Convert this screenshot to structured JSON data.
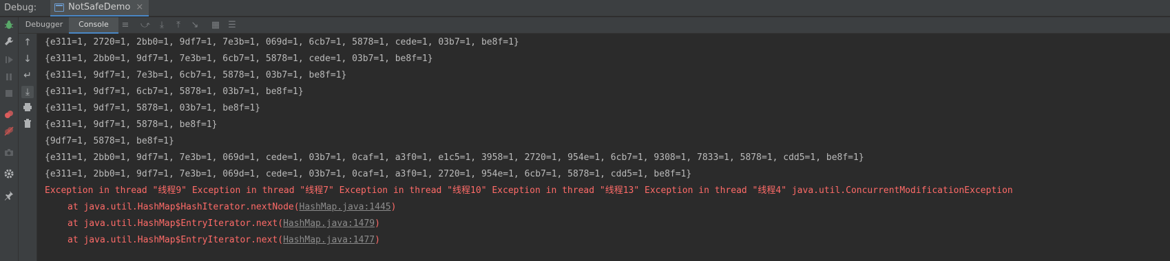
{
  "debug_bar": {
    "label": "Debug:",
    "session_tab": {
      "title": "NotSafeDemo",
      "close": "×"
    }
  },
  "tabs": [
    {
      "label": "Debugger",
      "active": false
    },
    {
      "label": "Console",
      "active": true
    }
  ],
  "left_toolbar_icons": [
    "bug-icon",
    "wrench-icon",
    "resume-icon",
    "pause-icon",
    "stop-icon",
    "view-breakpoints-icon",
    "mute-breakpoints-icon",
    "camera-icon",
    "settings-icon",
    "pin-icon"
  ],
  "header_icons": [
    "menu-icon",
    "step-over-icon",
    "step-into-icon",
    "step-out-icon",
    "run-to-cursor-icon",
    "evaluate-icon",
    "trace-icon"
  ],
  "console_toolbar_icons": [
    "up-arrow-icon",
    "down-arrow-icon",
    "soft-wrap-icon",
    "scroll-to-end-icon",
    "print-icon",
    "trash-icon"
  ],
  "console": {
    "output_lines": [
      "{e311=1, 2720=1, 2bb0=1, 9df7=1, 7e3b=1, 069d=1, 6cb7=1, 5878=1, cede=1, 03b7=1, be8f=1}",
      "{e311=1, 2bb0=1, 9df7=1, 7e3b=1, 6cb7=1, 5878=1, cede=1, 03b7=1, be8f=1}",
      "{e311=1, 9df7=1, 7e3b=1, 6cb7=1, 5878=1, 03b7=1, be8f=1}",
      "{e311=1, 9df7=1, 6cb7=1, 5878=1, 03b7=1, be8f=1}",
      "{e311=1, 9df7=1, 5878=1, 03b7=1, be8f=1}",
      "{e311=1, 9df7=1, 5878=1, be8f=1}",
      "{9df7=1, 5878=1, be8f=1}",
      "{e311=1, 2bb0=1, 9df7=1, 7e3b=1, 069d=1, cede=1, 03b7=1, 0caf=1, a3f0=1, e1c5=1, 3958=1, 2720=1, 954e=1, 6cb7=1, 9308=1, 7833=1, 5878=1, cdd5=1, be8f=1}",
      "{e311=1, 2bb0=1, 9df7=1, 7e3b=1, 069d=1, cede=1, 03b7=1, 0caf=1, a3f0=1, 2720=1, 954e=1, 6cb7=1, 5878=1, cdd5=1, be8f=1}"
    ],
    "exception_line": "Exception in thread \"线程9\" Exception in thread \"线程7\" Exception in thread \"线程10\" Exception in thread \"线程13\" Exception in thread \"线程4\" java.util.ConcurrentModificationException",
    "stack": [
      {
        "prefix": "at java.util.HashMap$HashIterator.nextNode(",
        "link": "HashMap.java:1445",
        "suffix": ")"
      },
      {
        "prefix": "at java.util.HashMap$EntryIterator.next(",
        "link": "HashMap.java:1479",
        "suffix": ")"
      },
      {
        "prefix": "at java.util.HashMap$EntryIterator.next(",
        "link": "HashMap.java:1477",
        "suffix": ")"
      }
    ]
  },
  "colors": {
    "background": "#2b2b2b",
    "toolbar": "#3c3f41",
    "accent": "#4a88c7",
    "error_text": "#ff6b68",
    "normal_text": "#bbbbbb"
  }
}
